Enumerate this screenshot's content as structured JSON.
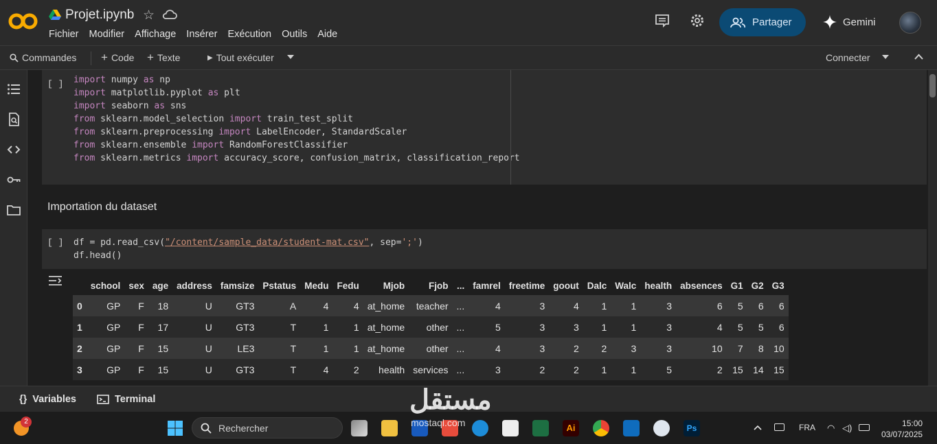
{
  "header": {
    "title": "Projet.ipynb",
    "menu": [
      "Fichier",
      "Modifier",
      "Affichage",
      "Insérer",
      "Exécution",
      "Outils",
      "Aide"
    ],
    "share_label": "Partager",
    "gemini_label": "Gemini",
    "brand_color": "#f9ab00",
    "share_bg": "#0b4a74"
  },
  "toolbar": {
    "commands": "Commandes",
    "code": "Code",
    "text": "Texte",
    "run_all": "Tout exécuter",
    "connect": "Connecter"
  },
  "cells": {
    "cell1_run": "[ ]",
    "cell1_lines": [
      {
        "kw": "import",
        "rest": " numpy ",
        "kw2": "as",
        "rest2": " np"
      },
      {
        "kw": "import",
        "rest": " matplotlib.pyplot ",
        "kw2": "as",
        "rest2": " plt"
      },
      {
        "kw": "import",
        "rest": " seaborn ",
        "kw2": "as",
        "rest2": " sns"
      },
      {
        "kw": "from",
        "rest": " sklearn.model_selection ",
        "kw2": "import",
        "rest2": " train_test_split"
      },
      {
        "kw": "from",
        "rest": " sklearn.preprocessing ",
        "kw2": "import",
        "rest2": " LabelEncoder, StandardScaler"
      },
      {
        "kw": "from",
        "rest": " sklearn.ensemble ",
        "kw2": "import",
        "rest2": " RandomForestClassifier"
      },
      {
        "kw": "from",
        "rest": " sklearn.metrics ",
        "kw2": "import",
        "rest2": " accuracy_score, confusion_matrix, classification_report"
      }
    ],
    "section_title": "Importation du dataset",
    "cell2_run": "[ ]",
    "cell2_line1_a": "df = pd.read_csv(",
    "cell2_line1_str": "\"/content/sample_data/student-mat.csv\"",
    "cell2_line1_b": ", sep=",
    "cell2_line1_sep": "';'",
    "cell2_line1_c": ")",
    "cell2_line2": "df.head()"
  },
  "table": {
    "columns": [
      "",
      "school",
      "sex",
      "age",
      "address",
      "famsize",
      "Pstatus",
      "Medu",
      "Fedu",
      "Mjob",
      "Fjob",
      "...",
      "famrel",
      "freetime",
      "goout",
      "Dalc",
      "Walc",
      "health",
      "absences",
      "G1",
      "G2",
      "G3"
    ],
    "rows": [
      [
        "0",
        "GP",
        "F",
        "18",
        "U",
        "GT3",
        "A",
        "4",
        "4",
        "at_home",
        "teacher",
        "...",
        "4",
        "3",
        "4",
        "1",
        "1",
        "3",
        "6",
        "5",
        "6",
        "6"
      ],
      [
        "1",
        "GP",
        "F",
        "17",
        "U",
        "GT3",
        "T",
        "1",
        "1",
        "at_home",
        "other",
        "...",
        "5",
        "3",
        "3",
        "1",
        "1",
        "3",
        "4",
        "5",
        "5",
        "6"
      ],
      [
        "2",
        "GP",
        "F",
        "15",
        "U",
        "LE3",
        "T",
        "1",
        "1",
        "at_home",
        "other",
        "...",
        "4",
        "3",
        "2",
        "2",
        "3",
        "3",
        "10",
        "7",
        "8",
        "10"
      ],
      [
        "3",
        "GP",
        "F",
        "15",
        "U",
        "GT3",
        "T",
        "4",
        "2",
        "health",
        "services",
        "...",
        "3",
        "2",
        "2",
        "1",
        "1",
        "5",
        "2",
        "15",
        "14",
        "15"
      ]
    ]
  },
  "bottom": {
    "variables": "Variables",
    "terminal": "Terminal"
  },
  "taskbar": {
    "search_placeholder": "Rechercher",
    "lang": "FRA",
    "time": "15:00",
    "date": "03/07/2025",
    "badge": "2"
  },
  "watermark": {
    "arabic": "مستقل",
    "latin": "mostaql.com"
  }
}
